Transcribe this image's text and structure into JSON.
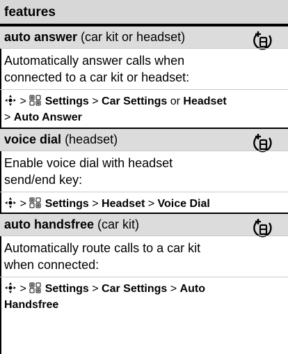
{
  "header": {
    "title": "features"
  },
  "features": [
    {
      "name": "auto answer",
      "qualifier": "(car kit or headset)",
      "desc_line1": "Automatically answer calls when",
      "desc_line2": "connected to a car kit or headset:",
      "path_line1": [
        {
          "t": "sep",
          "v": " > "
        },
        {
          "t": "b",
          "v": "Settings"
        },
        {
          "t": "sep",
          "v": " > "
        },
        {
          "t": "b",
          "v": "Car Settings"
        },
        {
          "t": "n",
          "v": " or "
        },
        {
          "t": "b",
          "v": "Headset"
        }
      ],
      "path_line2": [
        {
          "t": "sep",
          "v": "> "
        },
        {
          "t": "b",
          "v": "Auto Answer"
        }
      ]
    },
    {
      "name": "voice dial",
      "qualifier": "(headset)",
      "desc_line1": "Enable voice dial with headset",
      "desc_line2": "send/end key:",
      "path_line1": [
        {
          "t": "sep",
          "v": " > "
        },
        {
          "t": "b",
          "v": "Settings"
        },
        {
          "t": "sep",
          "v": " > "
        },
        {
          "t": "b",
          "v": "Headset"
        },
        {
          "t": "sep",
          "v": " > "
        },
        {
          "t": "b",
          "v": "Voice Dial"
        }
      ],
      "path_line2": []
    },
    {
      "name": "auto handsfree",
      "qualifier": "(car kit)",
      "desc_line1": "Automatically route calls to a car kit",
      "desc_line2": "when connected:",
      "path_line1": [
        {
          "t": "sep",
          "v": " > "
        },
        {
          "t": "b",
          "v": "Settings"
        },
        {
          "t": "sep",
          "v": " > "
        },
        {
          "t": "b",
          "v": "Car Settings"
        },
        {
          "t": "sep",
          "v": " > "
        },
        {
          "t": "b",
          "v": "Auto"
        }
      ],
      "path_line2": [
        {
          "t": "b",
          "v": "Handsfree"
        }
      ]
    }
  ],
  "icons": {
    "nav": "nav-key-icon",
    "settings": "settings-icon",
    "accessory": "accessory-icon"
  },
  "colors": {
    "title_bg": "#dcdcdc",
    "header_bg": "#d7d7d7"
  }
}
